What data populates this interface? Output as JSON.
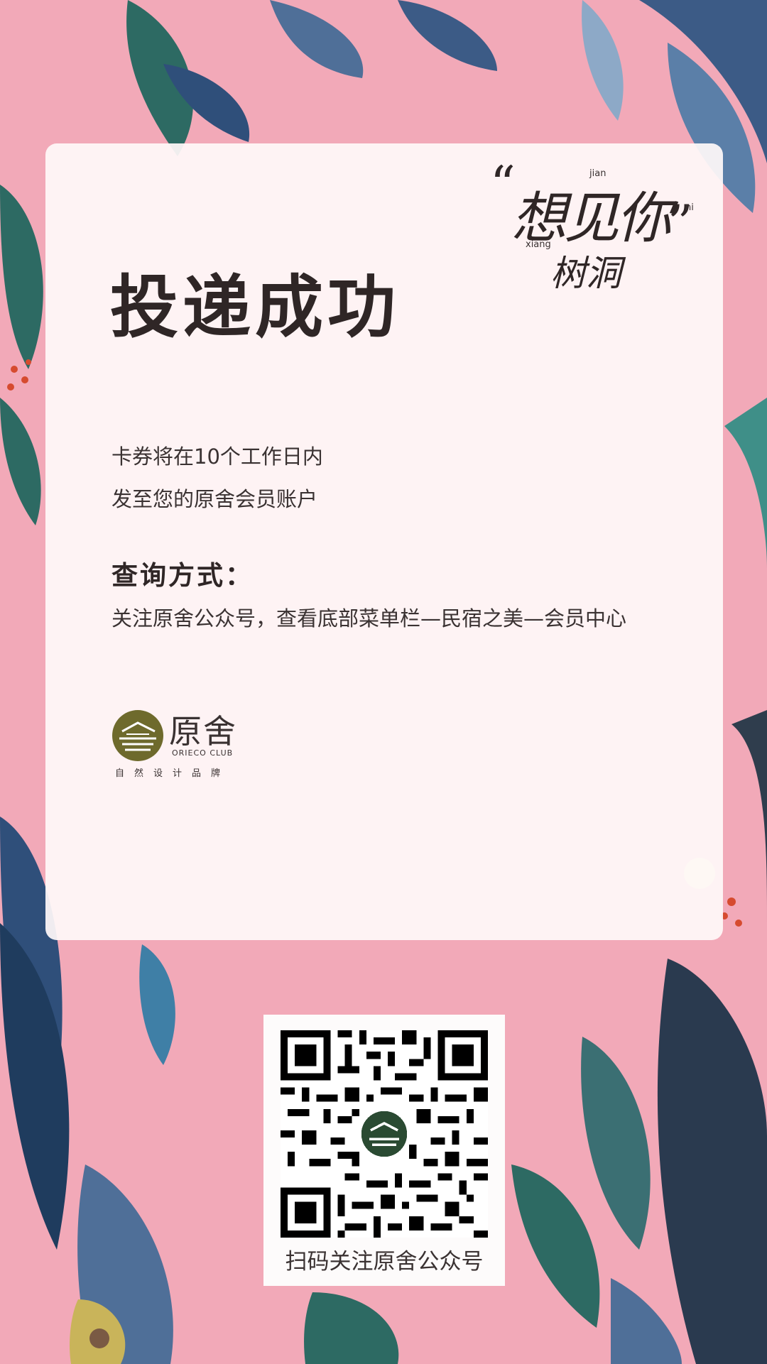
{
  "brand": {
    "quote_main": "想见你",
    "quote_sub": "树洞",
    "quote_open": "“",
    "quote_close": "”",
    "pinyin_jian": "jian",
    "pinyin_xiang": "xiang",
    "pinyin_ni": "ni"
  },
  "main": {
    "title": "投递成功",
    "line1": "卡券将在10个工作日内",
    "line2": "发至您的原舍会员账户",
    "query_label": "查询方式：",
    "query_text": "关注原舍公众号，查看底部菜单栏—民宿之美—会员中心"
  },
  "logo": {
    "name_cn": "原舍",
    "name_en": "ORIECO CLUB",
    "tagline": "自然设计品牌"
  },
  "qr": {
    "caption": "扫码关注原舍公众号"
  },
  "colors": {
    "background": "#f2a9b8",
    "text_dark": "#2f2626",
    "logo_olive": "#6e6a2c"
  }
}
